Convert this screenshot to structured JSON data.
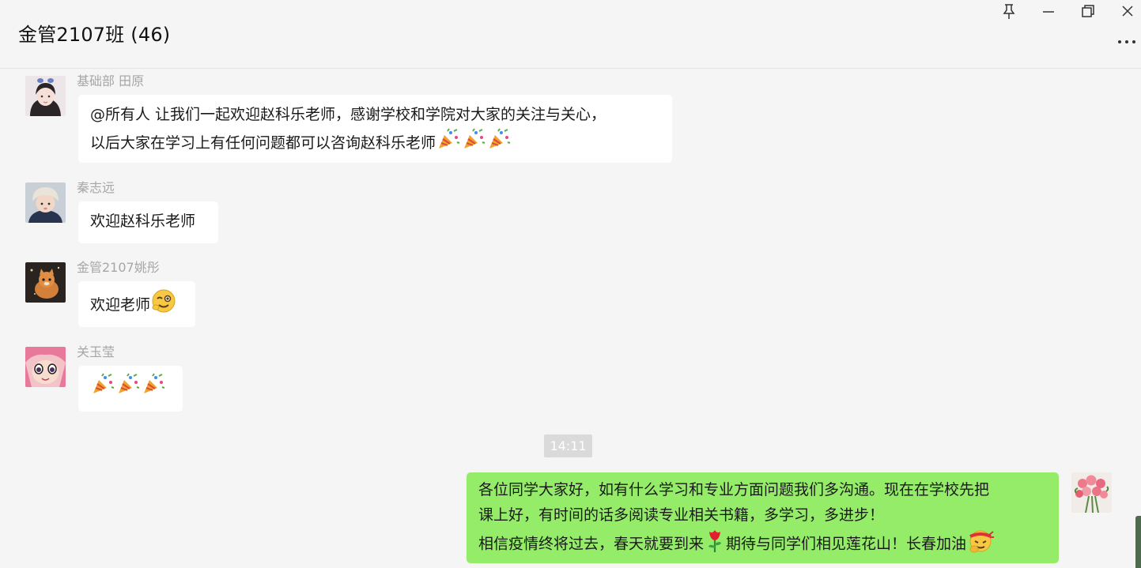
{
  "window": {
    "title": "金管2107班 (46)",
    "controls": [
      "pin-icon",
      "minimize-icon",
      "restore-icon",
      "close-icon",
      "more-icon"
    ]
  },
  "messages": [
    {
      "sender": "基础部 田原",
      "avatar": "girl-portrait-avatar",
      "lines": [
        "@所有人 让我们一起欢迎赵科乐老师，感谢学校和学院对大家的关注与关心，",
        "以后大家在学习上有任何问题都可以咨询赵科乐老师"
      ],
      "trailing_emoji": [
        "party-popper-emoji",
        "party-popper-emoji",
        "party-popper-emoji"
      ]
    },
    {
      "sender": "秦志远",
      "avatar": "child-in-hat-avatar",
      "text": "欢迎赵科乐老师"
    },
    {
      "sender": "金管2107姚彤",
      "avatar": "orange-cat-avatar",
      "text": "欢迎老师",
      "trailing_emoji": [
        "wink-emoji"
      ]
    },
    {
      "sender": "关玉莹",
      "avatar": "anime-girl-avatar",
      "emoji_only": [
        "party-popper-emoji",
        "party-popper-emoji",
        "party-popper-emoji"
      ]
    }
  ],
  "timestamp": "14:11",
  "own_message": {
    "avatar": "pink-roses-avatar",
    "lines": [
      "各位同学大家好，如有什么学习和专业方面问题我们多沟通。现在在学校先把",
      "课上好，有时间的话多阅读专业相关书籍，多学习，多进步！"
    ],
    "line3_part1": "相信疫情终将过去，春天就要到来",
    "line3_part2": "期待与同学们相见莲花山！长春加油",
    "emoji": [
      "rose-emoji",
      "fighting-emoji"
    ]
  },
  "colors": {
    "background": "#f5f5f5",
    "incoming_bubble": "#ffffff",
    "outgoing_bubble": "#95ec69",
    "sender_name": "#a6a6a6",
    "timestamp_bg": "#dadada"
  }
}
